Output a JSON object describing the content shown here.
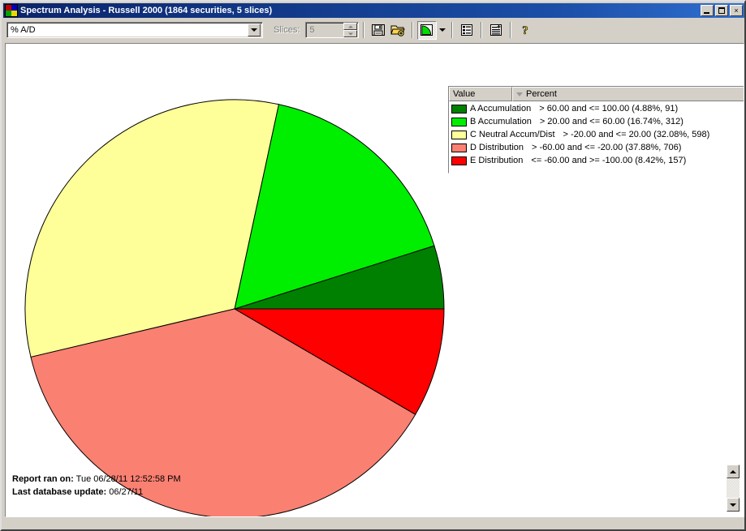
{
  "window": {
    "title": "Spectrum Analysis - Russell 2000 (1864 securities, 5 slices)",
    "icon": "pie-chart-app-icon",
    "minimize_label": "",
    "maximize_label": "",
    "close_label": "×"
  },
  "toolbar": {
    "indicator_value": "% A/D",
    "indicator_placeholder": "% A/D",
    "slices_label": "Slices:",
    "slices_value": "5",
    "buttons": [
      {
        "name": "save-button",
        "icon": "floppy-disk-icon",
        "label": "Save"
      },
      {
        "name": "open-button",
        "icon": "open-folder-icon",
        "label": "Open"
      },
      {
        "name": "chart-type-button",
        "icon": "pie-chart-icon",
        "label": "Chart Type"
      },
      {
        "name": "chart-type-dropdown",
        "icon": "chevron-down-icon",
        "label": "Chart Type Options"
      },
      {
        "name": "report-view-button",
        "icon": "list-report-icon",
        "label": "Report View"
      },
      {
        "name": "add-report-button",
        "icon": "list-add-icon",
        "label": "Add Report"
      },
      {
        "name": "help-button",
        "icon": "question-mark-icon",
        "label": "Help"
      }
    ]
  },
  "legend": {
    "columns": [
      "Value",
      "Percent"
    ],
    "sort_indicator": "descending",
    "rows": [
      {
        "color": "#008000",
        "label": "A Accumulation",
        "range": "> 60.00 and <= 100.00 (4.88%, 91)"
      },
      {
        "color": "#00ee00",
        "label": "B Accumulation",
        "range": "> 20.00 and <= 60.00 (16.74%, 312)"
      },
      {
        "color": "#ffff99",
        "label": "C Neutral Accum/Dist",
        "range": "> -20.00 and <= 20.00 (32.08%, 598)"
      },
      {
        "color": "#fa8072",
        "label": "D Distribution",
        "range": "> -60.00 and <= -20.00 (37.88%, 706)"
      },
      {
        "color": "#ff0000",
        "label": "E Distribution",
        "range": "<= -60.00 and >= -100.00 (8.42%, 157)"
      }
    ]
  },
  "footer": {
    "report_label": "Report ran on:",
    "report_value": "Tue 06/28/11 12:52:58 PM",
    "update_label": "Last database update:",
    "update_value": "06/27/11"
  },
  "scrollbar": {
    "up_arrow": "scroll-up-arrow",
    "down_arrow": "scroll-down-arrow"
  },
  "chart_data": {
    "type": "pie",
    "title": "Spectrum Analysis - Russell 2000",
    "subtitle": "1864 securities, 5 slices",
    "indicator": "% A/D",
    "total_securities": 1864,
    "slice_count": 5,
    "start_angle_deg": 0,
    "direction": "counterclockwise",
    "center": [
      282,
      327
    ],
    "radius": 258,
    "stroke": "#000000",
    "labels": [
      "A Accumulation",
      "B Accumulation",
      "C Neutral Accum/Dist",
      "D Distribution",
      "E Distribution"
    ],
    "values": [
      4.88,
      16.74,
      32.08,
      37.88,
      8.42
    ],
    "counts": [
      91,
      312,
      598,
      706,
      157
    ],
    "ranges": [
      "> 60.00 and <= 100.00",
      "> 20.00 and <= 60.00",
      "> -20.00 and <= 20.00",
      "> -60.00 and <= -20.00",
      "<= -60.00 and >= -100.00"
    ],
    "colors": [
      "#008000",
      "#00ee00",
      "#ffff99",
      "#fa8072",
      "#ff0000"
    ],
    "legend_position": "top-right"
  }
}
